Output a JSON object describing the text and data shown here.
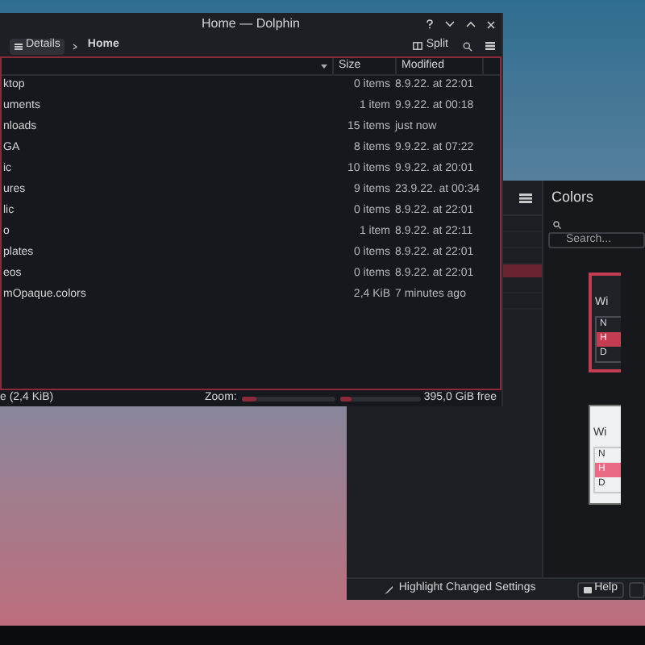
{
  "file_manager": {
    "window": {
      "title": "Home — Dolphin"
    },
    "toolbar": {
      "view_button": "Details",
      "location": "Home",
      "split_button": "Split"
    },
    "columns": [
      "Size",
      "Modified"
    ],
    "rows": [
      {
        "name": "ktop",
        "size": "0 items",
        "modified": "8.9.22. at 22:01"
      },
      {
        "name": "uments",
        "size": "1 item",
        "modified": "9.9.22. at 00:18"
      },
      {
        "name": "nloads",
        "size": "15 items",
        "modified": "just now"
      },
      {
        "name": "GA",
        "size": "8 items",
        "modified": "9.9.22. at 07:22"
      },
      {
        "name": "ic",
        "size": "10 items",
        "modified": "9.9.22. at 20:01"
      },
      {
        "name": "ures",
        "size": "9 items",
        "modified": "23.9.22. at 00:34"
      },
      {
        "name": "lic",
        "size": "0 items",
        "modified": "8.9.22. at 22:01"
      },
      {
        "name": "o",
        "size": "1 item",
        "modified": "8.9.22. at 22:11"
      },
      {
        "name": "plates",
        "size": "0 items",
        "modified": "8.9.22. at 22:01"
      },
      {
        "name": "eos",
        "size": "0 items",
        "modified": "8.9.22. at 22:01"
      },
      {
        "name": "mOpaque.colors",
        "size": "2,4 KiB",
        "modified": "7 minutes ago"
      }
    ],
    "status_bar": {
      "selection": "e (2,4 KiB)",
      "zoom_label": "Zoom:",
      "zoom": {
        "level": 0.15
      },
      "free_space": {
        "level": 0.15,
        "text": "395,0 GiB free"
      }
    }
  },
  "settings": {
    "title": "Colors",
    "search": {
      "placeholder": "Search..."
    },
    "schemes": [
      {
        "kind": "dark",
        "selected": true,
        "title": "Wi",
        "rows": [
          {
            "label": "N",
            "highlighted": false
          },
          {
            "label": "H",
            "highlighted": true
          },
          {
            "label": "D",
            "highlighted": false
          }
        ]
      },
      {
        "kind": "light",
        "selected": false,
        "title": "Wi",
        "rows": [
          {
            "label": "N",
            "highlighted": false
          },
          {
            "label": "H",
            "highlighted": true
          },
          {
            "label": "D",
            "highlighted": false
          }
        ]
      }
    ],
    "highlight_button": "Highlight Changed Settings",
    "help_button": "Help"
  }
}
